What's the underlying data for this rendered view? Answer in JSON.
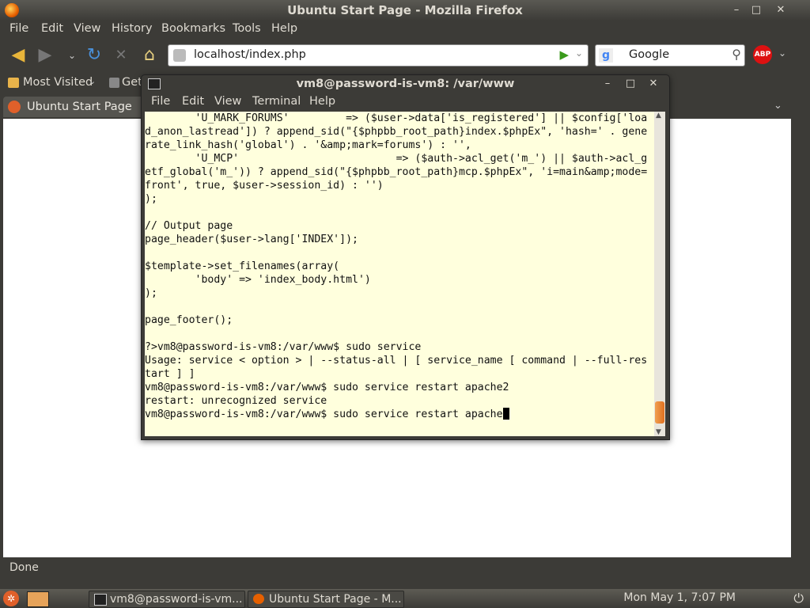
{
  "firefox": {
    "title": "Ubuntu Start Page - Mozilla Firefox",
    "menu": [
      "File",
      "Edit",
      "View",
      "History",
      "Bookmarks",
      "Tools",
      "Help"
    ],
    "url": "localhost/index.php",
    "search_engine": "Google",
    "bookmarks": {
      "most_visited": "Most Visited",
      "get": "Get"
    },
    "tab_label": "Ubuntu Start Page",
    "status": "Done",
    "icons": {
      "back": "back-arrow-icon",
      "forward": "forward-arrow-icon",
      "reload": "reload-icon",
      "stop": "stop-icon",
      "home": "home-icon",
      "adblock": "abp-icon"
    },
    "adblock_label": "ABP"
  },
  "terminal": {
    "title": "vm8@password-is-vm8: /var/www",
    "menu": [
      "File",
      "Edit",
      "View",
      "Terminal",
      "Help"
    ],
    "lines": [
      "        'U_MARK_FORUMS'         => ($user->data['is_registered'] || $config['loa",
      "d_anon_lastread']) ? append_sid(\"{$phpbb_root_path}index.$phpEx\", 'hash=' . gene",
      "rate_link_hash('global') . '&amp;mark=forums') : '',",
      "        'U_MCP'                         => ($auth->acl_get('m_') || $auth->acl_g",
      "etf_global('m_')) ? append_sid(\"{$phpbb_root_path}mcp.$phpEx\", 'i=main&amp;mode=",
      "front', true, $user->session_id) : '')",
      ");",
      "",
      "// Output page",
      "page_header($user->lang['INDEX']);",
      "",
      "$template->set_filenames(array(",
      "        'body' => 'index_body.html')",
      ");",
      "",
      "page_footer();",
      "",
      "?>vm8@password-is-vm8:/var/www$ sudo service",
      "Usage: service < option > | --status-all | [ service_name [ command | --full-res",
      "tart ] ]",
      "vm8@password-is-vm8:/var/www$ sudo service restart apache2",
      "restart: unrecognized service"
    ],
    "prompt_line": "vm8@password-is-vm8:/var/www$ sudo service restart apache"
  },
  "panel": {
    "tasks": [
      "vm8@password-is-vm...",
      "Ubuntu Start Page - M..."
    ],
    "clock": "Mon May  1,  7:07 PM"
  }
}
